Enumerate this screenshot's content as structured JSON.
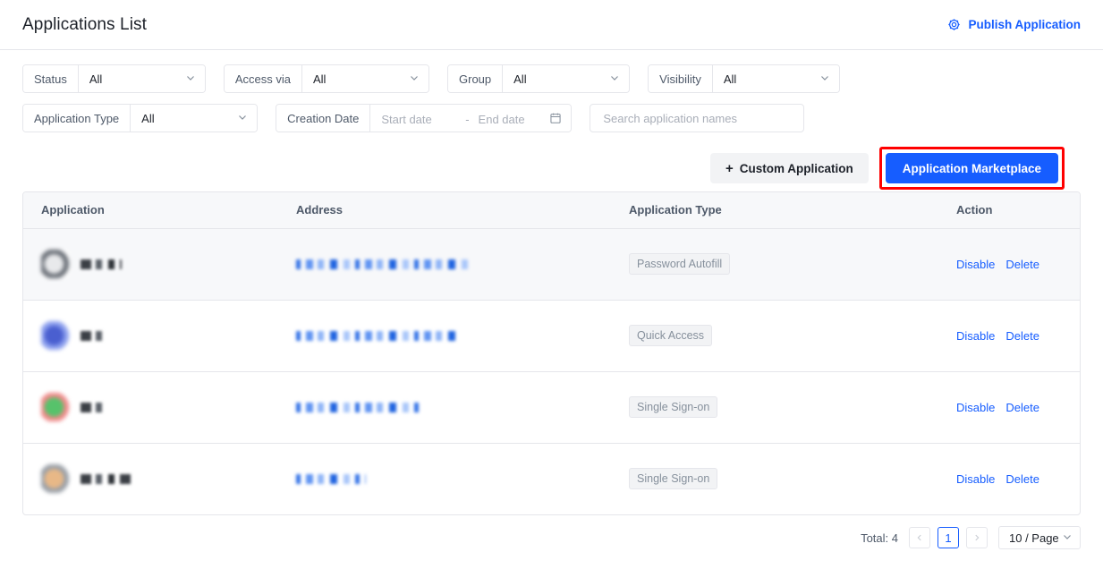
{
  "header": {
    "title": "Applications List",
    "publish_label": "Publish Application",
    "publish_icon": "gear-icon",
    "accent_color": "#165dff"
  },
  "filters": {
    "row1": [
      {
        "label": "Status",
        "value": "All",
        "icon": "chevron-down-icon"
      },
      {
        "label": "Access via",
        "value": "All",
        "icon": "chevron-down-icon"
      },
      {
        "label": "Group",
        "value": "All",
        "icon": "chevron-down-icon"
      },
      {
        "label": "Visibility",
        "value": "All",
        "icon": "chevron-down-icon"
      }
    ],
    "app_type": {
      "label": "Application Type",
      "value": "All",
      "icon": "chevron-down-icon"
    },
    "creation_date": {
      "label": "Creation Date",
      "start_placeholder": "Start date",
      "separator": "-",
      "end_placeholder": "End date",
      "icon": "calendar-icon"
    },
    "search": {
      "placeholder": "Search application names",
      "value": ""
    }
  },
  "toolbar": {
    "custom_app_label": "Custom Application",
    "custom_app_icon": "plus-icon",
    "marketplace_label": "Application Marketplace",
    "highlight_color": "#ff0000",
    "primary_color": "#165dff"
  },
  "table": {
    "columns": [
      "Application",
      "Address",
      "Application Type",
      "Action"
    ],
    "rows": [
      {
        "app_name": "",
        "icon_colors": [
          "#e8e9eb",
          "#6b7078"
        ],
        "address": "",
        "type": "Password Autofill",
        "actions": [
          "Disable",
          "Delete"
        ],
        "highlighted": true,
        "name_width": 46,
        "addr_width": 192
      },
      {
        "app_name": "",
        "icon_colors": [
          "#4a5fd0",
          "#8da0ee"
        ],
        "address": "",
        "type": "Quick Access",
        "actions": [
          "Disable",
          "Delete"
        ],
        "highlighted": false,
        "name_width": 28,
        "addr_width": 184
      },
      {
        "app_name": "",
        "icon_colors": [
          "#57c26b",
          "#f08a8a"
        ],
        "address": "",
        "type": "Single Sign-on",
        "actions": [
          "Disable",
          "Delete"
        ],
        "highlighted": false,
        "name_width": 28,
        "addr_width": 140
      },
      {
        "app_name": "",
        "icon_colors": [
          "#e8b887",
          "#9aa0a8"
        ],
        "address": "",
        "type": "Single Sign-on",
        "actions": [
          "Disable",
          "Delete"
        ],
        "highlighted": false,
        "name_width": 60,
        "addr_width": 78
      }
    ]
  },
  "pagination": {
    "total_label": "Total: 4",
    "prev_icon": "chevron-left-icon",
    "next_icon": "chevron-right-icon",
    "current_page": "1",
    "page_size_label": "10  / Page",
    "page_size_icon": "chevron-down-icon"
  }
}
